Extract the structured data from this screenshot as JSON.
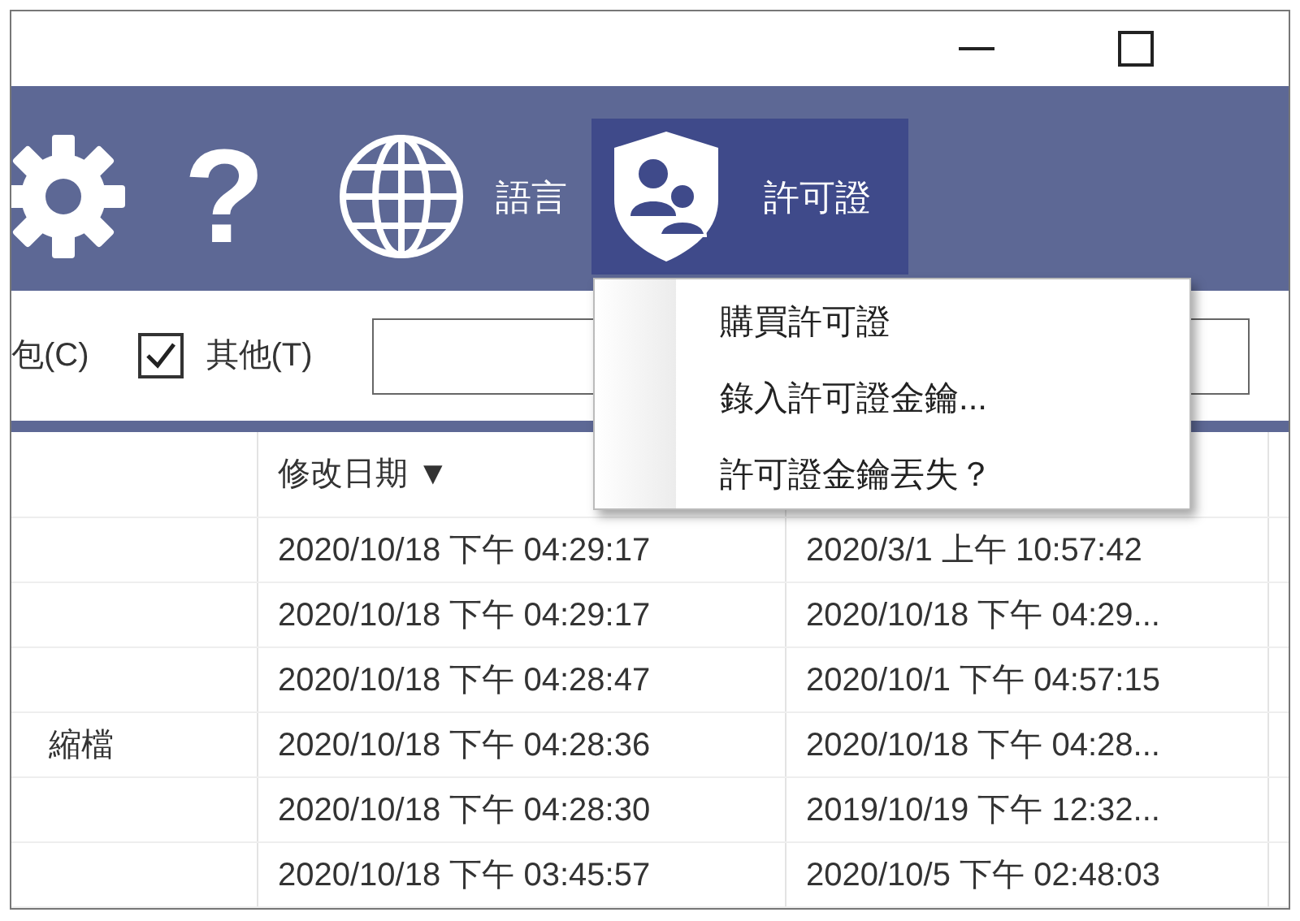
{
  "toolbar": [
    {
      "kind": "settings",
      "selected": false
    },
    {
      "kind": "help",
      "glyph": "?",
      "selected": false
    },
    {
      "kind": "language",
      "label": "語言",
      "selected": false
    },
    {
      "kind": "license",
      "label": "許可證",
      "selected": true
    }
  ],
  "filters": [
    {
      "kind": "text",
      "label": "包(C)"
    },
    {
      "kind": "checkbox",
      "label": "其他(T)",
      "checked": true
    }
  ],
  "table": {
    "header": {
      "column_2": "修改日期 ▼"
    },
    "rows": [
      {
        "column_2": "2020/10/18 下午 04:29:17",
        "column_3": "2020/3/1 上午 10:57:42"
      },
      {
        "column_2": "2020/10/18 下午 04:29:17",
        "column_3": "2020/10/18 下午 04:29..."
      },
      {
        "column_2": "2020/10/18 下午 04:28:47",
        "column_3": "2020/10/1 下午 04:57:15"
      },
      {
        "column_1": "縮檔",
        "column_2": "2020/10/18 下午 04:28:36",
        "column_3": "2020/10/18 下午 04:28..."
      },
      {
        "column_2": "2020/10/18 下午 04:28:30",
        "column_3": "2019/10/19 下午 12:32..."
      },
      {
        "column_2": "2020/10/18 下午 03:45:57",
        "column_3": "2020/10/5 下午 02:48:03"
      }
    ]
  },
  "menu": {
    "items": [
      {
        "label": "購買許可證"
      },
      {
        "label": "錄入許可證金鑰..."
      },
      {
        "label": "許可證金鑰丟失？"
      }
    ]
  }
}
